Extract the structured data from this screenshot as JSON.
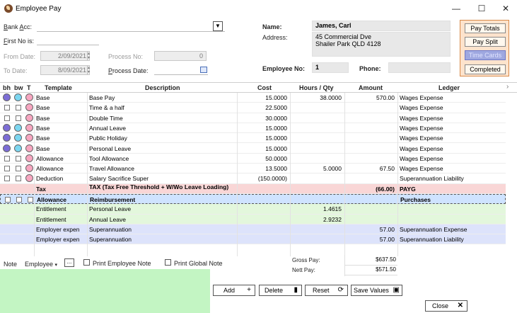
{
  "window": {
    "title": "Employee Pay",
    "minimize": "—",
    "maximize": "☐",
    "close": "✕"
  },
  "form": {
    "bank_acc_label": "Bank Acc:",
    "bank_acc_value": "",
    "first_no_label": "First No is:",
    "from_date_label": "From Date:",
    "from_date_value": "2/09/2021",
    "to_date_label": "To Date:",
    "to_date_value": "8/09/2021",
    "process_no_label": "Process No:",
    "process_no_value": "0",
    "process_date_label": "Process Date:",
    "name_label": "Name:",
    "name_value": "James, Carl",
    "address_label": "Address:",
    "address_line1": "45 Commercial Dve",
    "address_line2": "Shailer Park QLD 4128",
    "employee_no_label": "Employee No:",
    "employee_no_value": "1",
    "phone_label": "Phone:",
    "phone_value": ""
  },
  "side_buttons": {
    "pay_totals": "Pay Totals",
    "pay_split": "Pay Split",
    "time_cards": "Time Cards",
    "completed": "Completed"
  },
  "grid": {
    "headers": {
      "bh": "bh",
      "bw": "bw",
      "t": "T",
      "template": "Template",
      "description": "Description",
      "cost": "Cost",
      "hours": "Hours / Qty",
      "amount": "Amount",
      "ledger": "Ledger"
    },
    "rows": [
      {
        "type": "circles",
        "template": "Base",
        "description": "Base Pay",
        "cost": "15.0000",
        "hours": "38.0000",
        "amount": "570.00",
        "ledger": "Wages Expense",
        "style": ""
      },
      {
        "type": "checks-pink",
        "template": "Base",
        "description": "Time & a half",
        "cost": "22.5000",
        "hours": "",
        "amount": "",
        "ledger": "Wages Expense",
        "style": ""
      },
      {
        "type": "checks-pink",
        "template": "Base",
        "description": "Double Time",
        "cost": "30.0000",
        "hours": "",
        "amount": "",
        "ledger": "Wages Expense",
        "style": ""
      },
      {
        "type": "circles",
        "template": "Base",
        "description": "Annual Leave",
        "cost": "15.0000",
        "hours": "",
        "amount": "",
        "ledger": "Wages Expense",
        "style": ""
      },
      {
        "type": "circles",
        "template": "Base",
        "description": "Public Holiday",
        "cost": "15.0000",
        "hours": "",
        "amount": "",
        "ledger": "Wages Expense",
        "style": ""
      },
      {
        "type": "circles",
        "template": "Base",
        "description": "Personal Leave",
        "cost": "15.0000",
        "hours": "",
        "amount": "",
        "ledger": "Wages Expense",
        "style": ""
      },
      {
        "type": "checks-pink",
        "template": "Allowance",
        "description": "Tool Allowance",
        "cost": "50.0000",
        "hours": "",
        "amount": "",
        "ledger": "Wages Expense",
        "style": ""
      },
      {
        "type": "checks-pink",
        "template": "Allowance",
        "description": "Travel Allowance",
        "cost": "13.5000",
        "hours": "5.0000",
        "amount": "67.50",
        "ledger": "Wages Expense",
        "style": ""
      },
      {
        "type": "checks-pink",
        "template": "Deduction",
        "description": "Salary Sacrifice Super",
        "cost": "(150.0000)",
        "hours": "",
        "amount": "",
        "ledger": "Superannuation Liability",
        "style": ""
      },
      {
        "type": "none",
        "template": "Tax",
        "description": "TAX (Tax Free Threshold + W/Wo Leave Loading)",
        "cost": "",
        "hours": "",
        "amount": "(66.00)",
        "ledger": "PAYG",
        "style": "tax"
      },
      {
        "type": "checks",
        "template": "Allowance",
        "description": "Reimbursement",
        "cost": "",
        "hours": "",
        "amount": "",
        "ledger": "Purchases",
        "style": "sel"
      },
      {
        "type": "none",
        "template": "Entitlement",
        "description": "Personal Leave",
        "cost": "",
        "hours": "1.4615",
        "amount": "",
        "ledger": "",
        "style": "green"
      },
      {
        "type": "none",
        "template": "Entitlement",
        "description": "Annual Leave",
        "cost": "",
        "hours": "2.9232",
        "amount": "",
        "ledger": "",
        "style": "green"
      },
      {
        "type": "none",
        "template": "Employer expen",
        "description": "Superannuation",
        "cost": "",
        "hours": "",
        "amount": "57.00",
        "ledger": "Superannuation Expense",
        "style": "blue"
      },
      {
        "type": "none",
        "template": "Employer expen",
        "description": "Superannuation",
        "cost": "",
        "hours": "",
        "amount": "57.00",
        "ledger": "Superannuation Liability",
        "style": "blue"
      }
    ]
  },
  "notes": {
    "note_label": "Note",
    "note_type": "Employee",
    "ellipsis": "...",
    "print_employee_note": "Print Employee Note",
    "print_global_note": "Print Global Note"
  },
  "totals": {
    "gross_pay_label": "Gross Pay:",
    "gross_pay_value": "$637.50",
    "nett_pay_label": "Nett Pay:",
    "nett_pay_value": "$571.50"
  },
  "buttons": {
    "add": "Add",
    "delete": "Delete",
    "reset": "Reset",
    "save_values": "Save Values",
    "close": "Close"
  }
}
